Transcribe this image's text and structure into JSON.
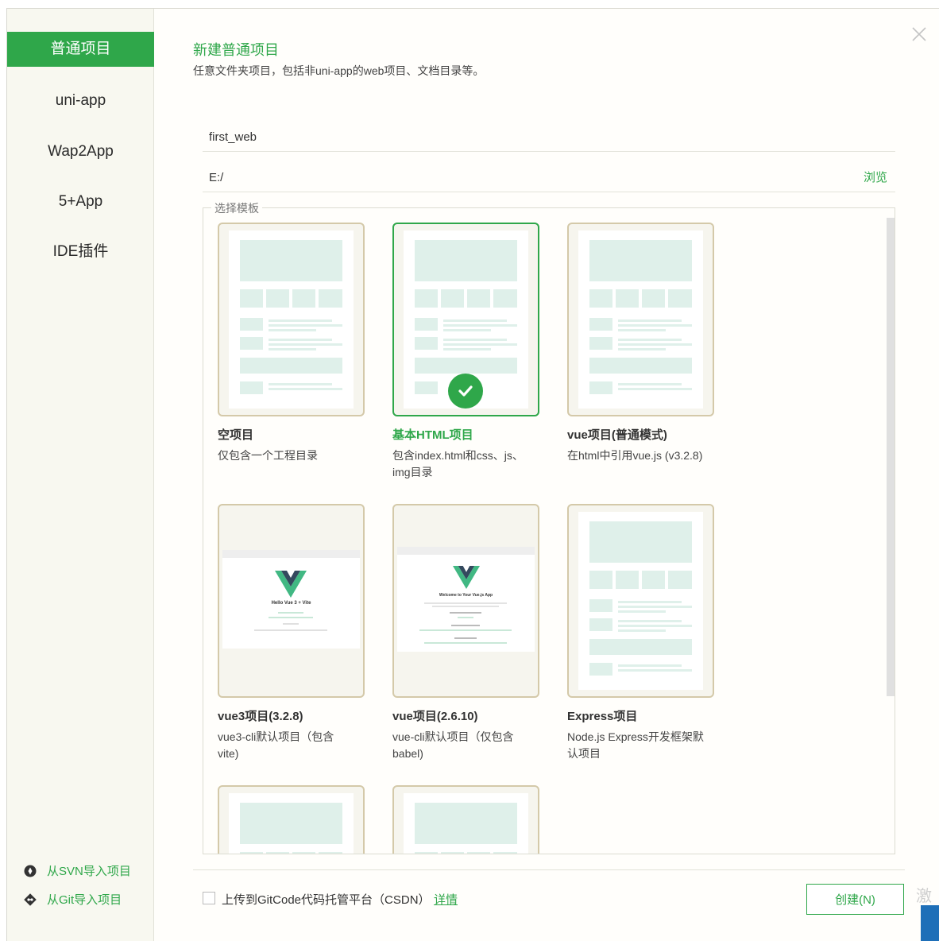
{
  "sidebar": {
    "items": [
      {
        "label": "普通项目",
        "active": true
      },
      {
        "label": "uni-app",
        "active": false
      },
      {
        "label": "Wap2App",
        "active": false
      },
      {
        "label": "5+App",
        "active": false
      },
      {
        "label": "IDE插件",
        "active": false
      }
    ],
    "svn_import": "从SVN导入项目",
    "git_import": "从Git导入项目"
  },
  "header": {
    "title": "新建普通项目",
    "subtitle": "任意文件夹项目，包括非uni-app的web项目、文档目录等。"
  },
  "form": {
    "project_name": "first_web",
    "location": "E:/",
    "browse_label": "浏览"
  },
  "templates": {
    "legend": "选择模板",
    "items": [
      {
        "title": "空项目",
        "desc": "仅包含一个工程目录",
        "selected": false
      },
      {
        "title": "基本HTML项目",
        "desc": "包含index.html和css、js、img目录",
        "selected": true
      },
      {
        "title": "vue项目(普通模式)",
        "desc": "在html中引用vue.js (v3.2.8)",
        "selected": false
      },
      {
        "title": "vue3项目(3.2.8)",
        "desc": "vue3-cli默认项目（包含vite)",
        "selected": false
      },
      {
        "title": "vue项目(2.6.10)",
        "desc": "vue-cli默认项目（仅包含babel)",
        "selected": false
      },
      {
        "title": "Express项目",
        "desc": "Node.js Express开发框架默认项目",
        "selected": false
      }
    ],
    "vue3_shot_title": "Hello Vue 3 + Vite",
    "vue2_shot_title": "Welcome to Your Vue.js App"
  },
  "footer": {
    "upload_label": "上传到GitCode代码托管平台（CSDN）",
    "details_link": "详情",
    "create_button": "创建(N)"
  },
  "edge_text": "激",
  "colors": {
    "accent": "#2fa74a",
    "thumb_border": "#d4c9a9",
    "placeholder": "#dff0ea"
  }
}
